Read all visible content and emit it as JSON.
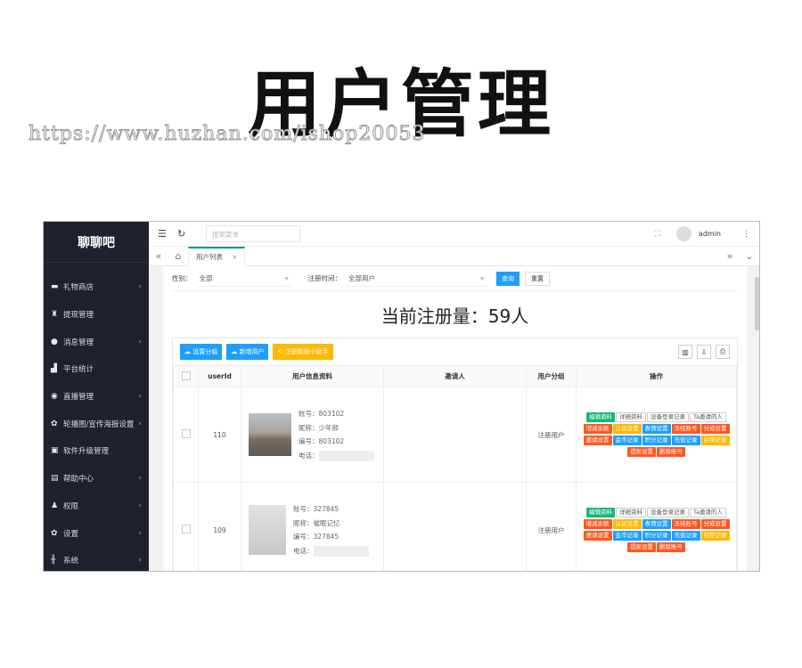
{
  "banner": {
    "title": "用户管理",
    "watermark": "https://www.huzhan.com/ishop20053"
  },
  "sidebar": {
    "brand": "聊聊吧",
    "items": [
      {
        "label": "礼物商店",
        "icon": "gift-icon",
        "arrow": "‹"
      },
      {
        "label": "提现管理",
        "icon": "money-bag-icon",
        "arrow": ""
      },
      {
        "label": "消息管理",
        "icon": "chat-icon",
        "arrow": "‹"
      },
      {
        "label": "平台统计",
        "icon": "bar-chart-icon",
        "arrow": ""
      },
      {
        "label": "直播管理",
        "icon": "play-circle-icon",
        "arrow": "‹"
      },
      {
        "label": "轮播图/宣传海报设置",
        "icon": "gear-icon",
        "arrow": "‹"
      },
      {
        "label": "软件升级管理",
        "icon": "briefcase-icon",
        "arrow": ""
      },
      {
        "label": "帮助中心",
        "icon": "document-icon",
        "arrow": "‹"
      },
      {
        "label": "权限",
        "icon": "user-icon",
        "arrow": "‹"
      },
      {
        "label": "设置",
        "icon": "gear-icon",
        "arrow": "‹"
      },
      {
        "label": "系统",
        "icon": "sliders-icon",
        "arrow": "‹"
      }
    ]
  },
  "topbar": {
    "search_placeholder": "搜索菜单",
    "user": "admin"
  },
  "tabs": [
    {
      "label": "用户列表"
    }
  ],
  "filter": {
    "gender_label": "性别：",
    "gender_value": "全部",
    "time_label": "注册时间：",
    "time_value": "全部用户",
    "query": "查询",
    "reset": "重置"
  },
  "stat": "当前注册量：59人",
  "toolbar": {
    "set_group": "设置分组",
    "add_user": "新增用户",
    "helper": "注册数据小助手"
  },
  "table": {
    "headers": [
      "",
      "userId",
      "用户信息资料",
      "邀请人",
      "用户分组",
      "操作"
    ],
    "rows": [
      {
        "userid": "110",
        "account": "账号：803102",
        "nickname": "昵称：少年郎",
        "number": "编号：803102",
        "phone": "电话：",
        "inviter": "",
        "group": "注册用户"
      },
      {
        "userid": "109",
        "account": "账号：327845",
        "nickname": "昵称：催眠记忆",
        "number": "编号：327845",
        "phone": "电话：",
        "inviter": "",
        "group": "注册用户"
      }
    ],
    "ops": [
      {
        "label": "编辑资料",
        "style": "green"
      },
      {
        "label": "详细资料",
        "style": "white"
      },
      {
        "label": "设备登录记录",
        "style": "white"
      },
      {
        "label": "Ta邀请的人",
        "style": "white"
      },
      {
        "label": "增减余额",
        "style": "red"
      },
      {
        "label": "认证设置",
        "style": "orange"
      },
      {
        "label": "表情设置",
        "style": "blue"
      },
      {
        "label": "冻结账号",
        "style": "red"
      },
      {
        "label": "分成设置",
        "style": "red"
      },
      {
        "label": "邀请设置",
        "style": "red"
      },
      {
        "label": "金币记录",
        "style": "blue"
      },
      {
        "label": "积分记录",
        "style": "blue"
      },
      {
        "label": "充值记录",
        "style": "blue"
      },
      {
        "label": "封禁记录",
        "style": "orange"
      },
      {
        "label": "提现设置",
        "style": "red"
      },
      {
        "label": "删除账号",
        "style": "red"
      }
    ]
  }
}
